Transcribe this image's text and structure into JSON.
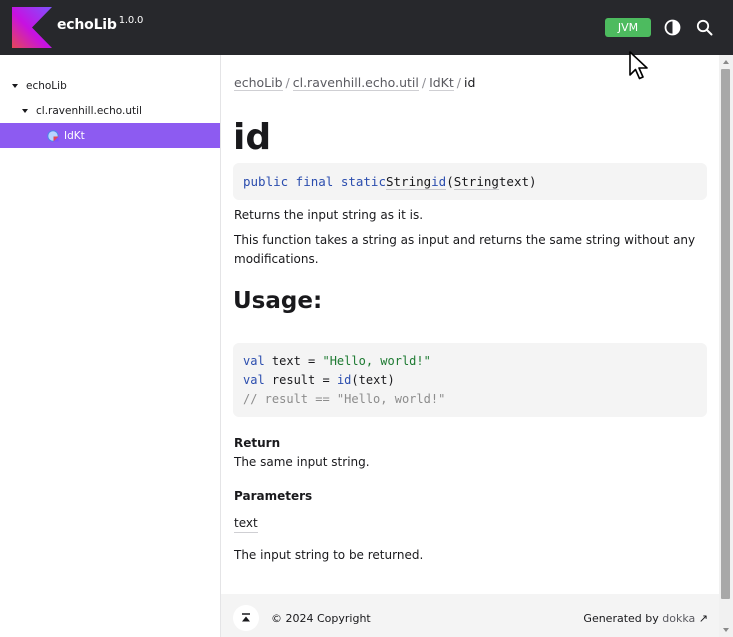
{
  "header": {
    "brand_name": "echoLib",
    "version": "1.0.0",
    "platform_button": "JVM",
    "icons": [
      "kotlin-logo",
      "theme-toggle-icon",
      "search-icon"
    ]
  },
  "sidebar": {
    "items": [
      {
        "label": "echoLib"
      },
      {
        "label": "cl.ravenhill.echo.util"
      },
      {
        "label": "IdKt",
        "selected": true
      }
    ]
  },
  "breadcrumb": {
    "items": [
      "echoLib",
      "cl.ravenhill.echo.util",
      "IdKt"
    ],
    "current": "id",
    "separator": "/"
  },
  "doc": {
    "title": "id",
    "signature": {
      "modifiers": "public final static",
      "return_type": "String",
      "name": "id",
      "param_type": "String",
      "param_name": "text"
    },
    "summary": "Returns the input string as it is.",
    "description": "This function takes a string as input and returns the same string without any modifications.",
    "usage_heading": "Usage:",
    "usage_code": {
      "line1_kw": "val",
      "line1_rest": " text = ",
      "line1_str": "\"Hello, world!\"",
      "line2_kw": "val",
      "line2_rest": " result = ",
      "line2_fn": "id",
      "line2_args": "(text)",
      "line3_comment": "// result == \"Hello, world!\""
    },
    "return_heading": "Return",
    "return_text": "The same input string.",
    "parameters_heading": "Parameters",
    "param_name": "text",
    "param_description": "The input string to be returned."
  },
  "footer": {
    "copyright": "© 2024 Copyright",
    "generated_by": "Generated by",
    "generator_link": "dokka"
  },
  "colors": {
    "header_bg": "#27282c",
    "accent": "#8d5bf1",
    "platform_green": "#4dbb5f"
  }
}
